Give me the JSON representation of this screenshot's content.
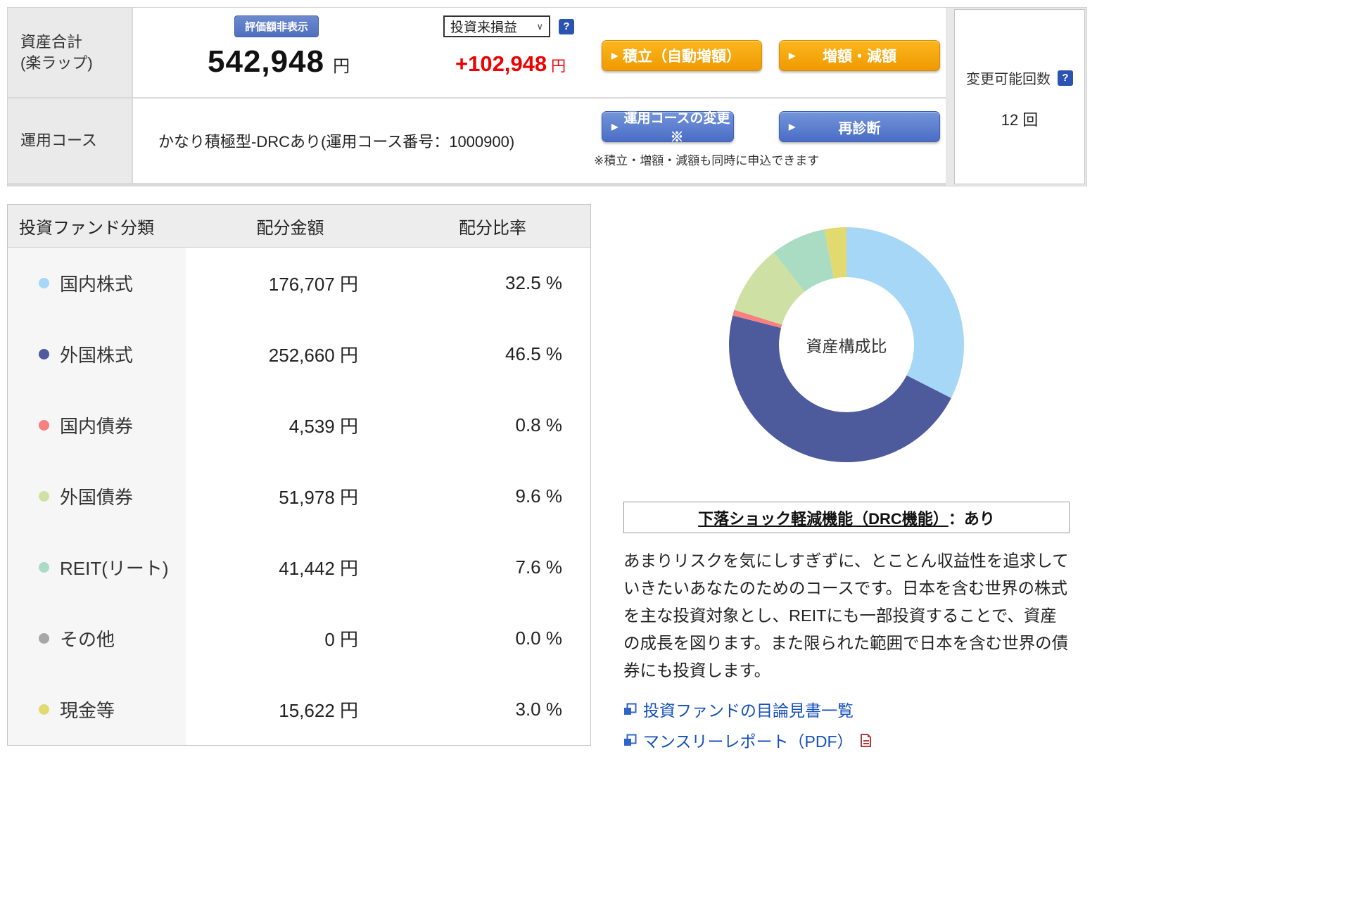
{
  "header": {
    "asset_total_label": "資産合計\n(楽ラップ)",
    "hide_valuation_button": "評価額非表示",
    "total_amount": "542,948",
    "total_unit": "円",
    "pl_select_value": "投資来損益",
    "pl_help_icon": "?",
    "pl_amount": "+102,948",
    "pl_unit": "円",
    "tsumitate_button": "積立（自動増額）",
    "zougaku_button": "増額・減額",
    "course_label": "運用コース",
    "course_value": "かなり積極型-DRCあり(運用コース番号：1000900)",
    "course_change_button": "運用コースの変更※",
    "rediagnosis_button": "再診断",
    "course_note": "※積立・増額・減額も同時に申込できます",
    "change_count": {
      "label": "変更可能回数",
      "help_icon": "?",
      "value": "12 回"
    }
  },
  "table": {
    "headers": [
      "投資ファンド分類",
      "配分金額",
      "配分比率"
    ],
    "rows": [
      {
        "label": "国内株式",
        "color": "#a7d7f6",
        "amount": "176,707 円",
        "ratio": "32.5 %"
      },
      {
        "label": "外国株式",
        "color": "#4d5a9c",
        "amount": "252,660 円",
        "ratio": "46.5 %"
      },
      {
        "label": "国内債券",
        "color": "#f8807f",
        "amount": "4,539 円",
        "ratio": "0.8 %"
      },
      {
        "label": "外国債券",
        "color": "#cfe0a4",
        "amount": "51,978 円",
        "ratio": "9.6 %"
      },
      {
        "label": "REIT(リート)",
        "color": "#a9dcc2",
        "amount": "41,442 円",
        "ratio": "7.6 %"
      },
      {
        "label": "その他",
        "color": "#a7a7a7",
        "amount": "0 円",
        "ratio": "0.0 %"
      },
      {
        "label": "現金等",
        "color": "#e3da6f",
        "amount": "15,622 円",
        "ratio": "3.0 %"
      }
    ]
  },
  "chart_data": {
    "type": "pie",
    "variant": "donut",
    "center_label": "資産構成比",
    "categories": [
      "国内株式",
      "外国株式",
      "国内債券",
      "外国債券",
      "REIT(リート)",
      "その他",
      "現金等"
    ],
    "values": [
      32.5,
      46.5,
      0.8,
      9.6,
      7.6,
      0.0,
      3.0
    ],
    "colors": [
      "#a7d7f6",
      "#4d5a9c",
      "#f8807f",
      "#cfe0a4",
      "#a9dcc2",
      "#a7a7a7",
      "#e3da6f"
    ],
    "start_angle_deg": -90,
    "direction": "clockwise",
    "legend_position": "none"
  },
  "drc": {
    "title_underlined": "下落ショック軽減機能（DRC機能）",
    "title_suffix": "：あり",
    "description": "あまりリスクを気にしすぎずに、とことん収益性を追求していきたいあなたのためのコースです。日本を含む世界の株式を主な投資対象とし、REITにも一部投資することで、資産の成長を図ります。また限られた範囲で日本を含む世界の債券にも投資します。"
  },
  "links": {
    "prospectus": "投資ファンドの目論見書一覧",
    "monthly_report": "マンスリーレポート（PDF）"
  },
  "colors": {
    "accent_orange": "#f5a301",
    "accent_blue": "#5b80d0",
    "pl_positive": "#ee0000",
    "link_blue": "#1550bb"
  }
}
